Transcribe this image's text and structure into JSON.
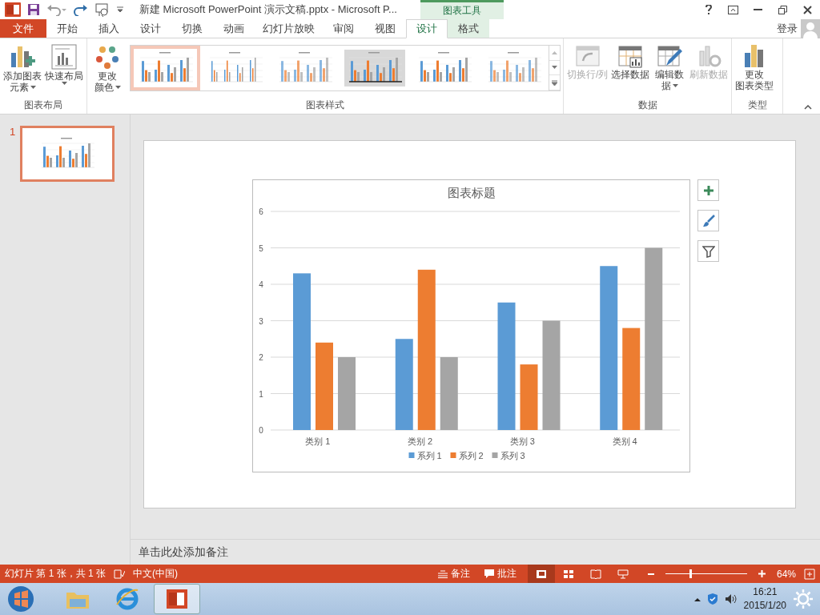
{
  "title_bar": {
    "title": "新建 Microsoft PowerPoint 演示文稿.pptx - Microsoft P...",
    "context_group": "图表工具"
  },
  "ribbon_tabs": [
    {
      "label": "文件",
      "kind": "file",
      "selected": false
    },
    {
      "label": "开始",
      "kind": "normal",
      "selected": false
    },
    {
      "label": "插入",
      "kind": "normal",
      "selected": false
    },
    {
      "label": "设计",
      "kind": "normal",
      "selected": false
    },
    {
      "label": "切换",
      "kind": "normal",
      "selected": false
    },
    {
      "label": "动画",
      "kind": "normal",
      "selected": false
    },
    {
      "label": "幻灯片放映",
      "kind": "normal",
      "selected": false
    },
    {
      "label": "审阅",
      "kind": "normal",
      "selected": false
    },
    {
      "label": "视图",
      "kind": "normal",
      "selected": false
    },
    {
      "label": "设计",
      "kind": "context",
      "selected": true
    },
    {
      "label": "格式",
      "kind": "context",
      "selected": false
    }
  ],
  "account": {
    "label": "登录"
  },
  "ribbon_groups": [
    {
      "label": "图表布局",
      "buttons": [
        {
          "lines": [
            "添加图表",
            "元素"
          ],
          "dropdown": true,
          "disabled": false
        },
        {
          "lines": [
            "快速布局"
          ],
          "dropdown": true,
          "disabled": false
        }
      ]
    },
    {
      "label": "图表样式",
      "buttons": [
        {
          "lines": [
            "更改",
            "颜色"
          ],
          "dropdown": true,
          "disabled": false
        }
      ],
      "gallery": [
        {
          "selected": true
        },
        {
          "selected": false
        },
        {
          "selected": false
        },
        {
          "selected": false
        },
        {
          "selected": false
        },
        {
          "selected": false
        }
      ]
    },
    {
      "label": "数据",
      "buttons": [
        {
          "lines": [
            "切换行/列"
          ],
          "dropdown": false,
          "disabled": true
        },
        {
          "lines": [
            "选择数据"
          ],
          "dropdown": false,
          "disabled": false
        },
        {
          "lines": [
            "编辑数",
            "据"
          ],
          "dropdown": true,
          "disabled": false
        },
        {
          "lines": [
            "刷新数据"
          ],
          "dropdown": false,
          "disabled": true
        }
      ]
    },
    {
      "label": "类型",
      "buttons": [
        {
          "lines": [
            "更改",
            "图表类型"
          ],
          "dropdown": false,
          "disabled": false
        }
      ]
    }
  ],
  "slides": [
    {
      "number": "1",
      "selected": true
    }
  ],
  "chart": {
    "chart_data": {
      "type": "bar",
      "title": "图表标题",
      "categories": [
        "类别 1",
        "类别 2",
        "类别 3",
        "类别 4"
      ],
      "series": [
        {
          "name": "系列 1",
          "color": "#5b9bd5",
          "values": [
            4.3,
            2.5,
            3.5,
            4.5
          ]
        },
        {
          "name": "系列 2",
          "color": "#ed7d31",
          "values": [
            2.4,
            4.4,
            1.8,
            2.8
          ]
        },
        {
          "name": "系列 3",
          "color": "#a5a5a5",
          "values": [
            2,
            2,
            3,
            5
          ]
        }
      ],
      "ylim": [
        0,
        6
      ],
      "yticks": [
        0,
        1,
        2,
        3,
        4,
        5,
        6
      ],
      "grid": true,
      "legend": "bottom"
    }
  },
  "notes": {
    "placeholder": "单击此处添加备注"
  },
  "status_bar": {
    "slide_info": "幻灯片 第 1 张，共 1 张",
    "language": "中文(中国)",
    "notes": "备注",
    "comments": "批注",
    "views": [
      {
        "selected": true
      },
      {
        "selected": false
      },
      {
        "selected": false
      },
      {
        "selected": false
      }
    ],
    "zoom": {
      "level": 0.3,
      "reading": "64%"
    }
  },
  "taskbar": {
    "apps": [
      {
        "selected": false
      },
      {
        "selected": false
      },
      {
        "selected": true
      }
    ],
    "time": "16:21",
    "date": "2015/1/20"
  }
}
